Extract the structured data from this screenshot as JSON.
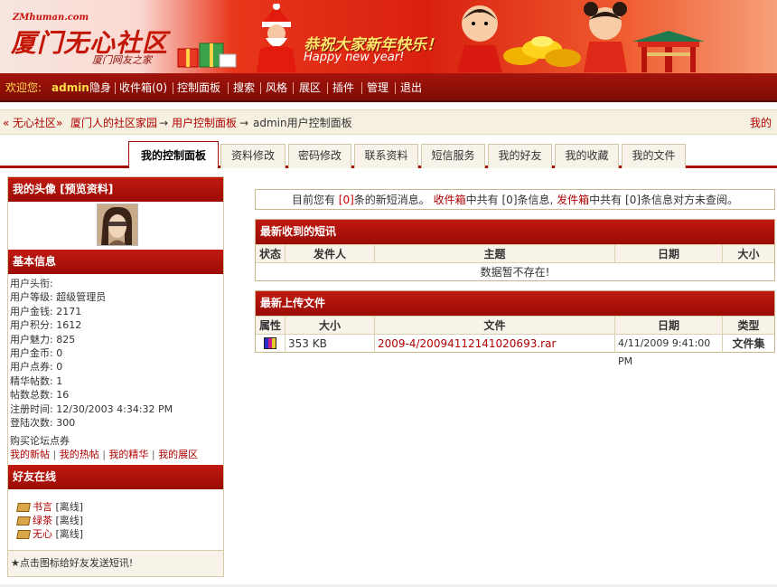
{
  "banner": {
    "site_url": "ZMhuman.com",
    "site_name": "厦门无心社区",
    "site_slogan": "厦门网友之家",
    "greeting": "恭祝大家新年快乐！",
    "greeting_en": "Happy new year!"
  },
  "menu": {
    "welcome": "欢迎您:",
    "username": "admin",
    "items": [
      "隐身",
      "收件箱(0)",
      "控制面板",
      "搜索",
      "风格",
      "展区",
      "插件",
      "管理",
      "退出"
    ]
  },
  "breadcrumb": {
    "prefix": "«",
    "home": "无心社区",
    "home_sub": "厦门人的社区家园",
    "arrow1": "→",
    "section": "用户控制面板",
    "arrow2": "→",
    "current": "admin用户控制面板",
    "right_link": "我的"
  },
  "tabs": [
    "我的控制面板",
    "资料修改",
    "密码修改",
    "联系资料",
    "短信服务",
    "我的好友",
    "我的收藏",
    "我的文件"
  ],
  "sidebar": {
    "avatar_title": "我的头像",
    "avatar_preview": "[预览资料]",
    "basic_title": "基本信息",
    "info": [
      {
        "label": "用户头衔:",
        "value": ""
      },
      {
        "label": "用户等级:",
        "value": "超级管理员"
      },
      {
        "label": "用户金钱:",
        "value": "2171"
      },
      {
        "label": "用户积分:",
        "value": "1612"
      },
      {
        "label": "用户魅力:",
        "value": "825"
      },
      {
        "label": "用户金币:",
        "value": "0"
      },
      {
        "label": "用户点券:",
        "value": "0"
      },
      {
        "label": "精华帖数:",
        "value": "1"
      },
      {
        "label": "帖数总数:",
        "value": "16"
      },
      {
        "label": "注册时间:",
        "value": "12/30/2003 4:34:32 PM"
      },
      {
        "label": "登陆次数:",
        "value": "300"
      }
    ],
    "buy_link": "购买论坛点券",
    "links": [
      "我的新帖",
      "我的热帖",
      "我的精华",
      "我的展区"
    ],
    "friends_title": "好友在线",
    "friends": [
      {
        "name": "书言",
        "status": "[离线]"
      },
      {
        "name": "绿茶",
        "status": "[离线]"
      },
      {
        "name": "无心",
        "status": "[离线]"
      }
    ],
    "hint": "★点击图标给好友发送短讯!"
  },
  "main": {
    "notice": {
      "t1": "目前您有",
      "n1": "[0]",
      "t2": "条的新短消息。",
      "inbox": "收件箱",
      "t3": "中共有",
      "n2": "[0]",
      "t4": "条信息,",
      "outbox": "发件箱",
      "t5": "中共有",
      "n3": "[0]",
      "t6": "条信息对方未查阅。"
    },
    "messages": {
      "title": "最新收到的短讯",
      "columns": [
        "状态",
        "发件人",
        "主题",
        "日期",
        "大小"
      ],
      "empty": "数据暂不存在!"
    },
    "files": {
      "title": "最新上传文件",
      "columns": [
        "属性",
        "大小",
        "文件",
        "日期",
        "类型"
      ],
      "rows": [
        {
          "size": "353 KB",
          "file": "2009-4/20094112141020693.rar",
          "date": "4/11/2009 9:41:00 PM",
          "type": "文件集"
        }
      ]
    }
  }
}
